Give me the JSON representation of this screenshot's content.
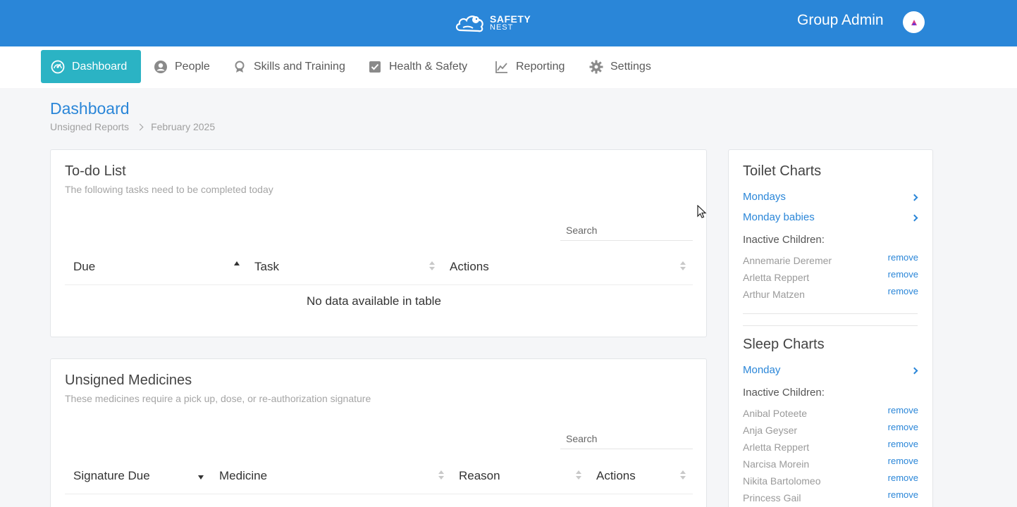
{
  "header": {
    "logo_line1": "SAFETY",
    "logo_line2": "NEST",
    "user_label": "Group Admin"
  },
  "nav": {
    "items": [
      {
        "label": "Dashboard",
        "icon": "dashboard-gauge-icon",
        "active": true
      },
      {
        "label": "People",
        "icon": "person-circle-icon"
      },
      {
        "label": "Skills and Training",
        "icon": "award-ribbon-icon"
      },
      {
        "label": "Health & Safety",
        "icon": "checkbox-icon"
      },
      {
        "label": "Reporting",
        "icon": "line-chart-icon"
      },
      {
        "label": "Settings",
        "icon": "gear-icon"
      }
    ]
  },
  "page": {
    "title": "Dashboard",
    "breadcrumb": [
      "Unsigned Reports",
      "February 2025"
    ]
  },
  "todo": {
    "title": "To-do List",
    "subtitle": "The following tasks need to be completed today",
    "search_label": "Search",
    "columns": [
      "Due",
      "Task",
      "Actions"
    ],
    "empty_message": "No data available in table"
  },
  "medicines": {
    "title": "Unsigned Medicines",
    "subtitle": "These medicines require a pick up, dose, or re-authorization signature",
    "search_label": "Search",
    "columns": [
      "Signature Due",
      "Medicine",
      "Reason",
      "Actions"
    ]
  },
  "toilet": {
    "title": "Toilet Charts",
    "links": [
      "Mondays",
      "Monday babies"
    ],
    "inactive_label": "Inactive Children:",
    "children": [
      "Annemarie Deremer",
      "Arletta Reppert",
      "Arthur Matzen"
    ],
    "remove_label": "remove"
  },
  "sleep": {
    "title": "Sleep Charts",
    "links": [
      "Monday"
    ],
    "inactive_label": "Inactive Children:",
    "children": [
      "Anibal Poteete",
      "Anja Geyser",
      "Arletta Reppert",
      "Narcisa Morein",
      "Nikita Bartolomeo",
      "Princess Gail"
    ],
    "remove_label": "remove"
  },
  "colors": {
    "brand_blue": "#2a86d8",
    "active_teal": "#2bb3c4"
  }
}
